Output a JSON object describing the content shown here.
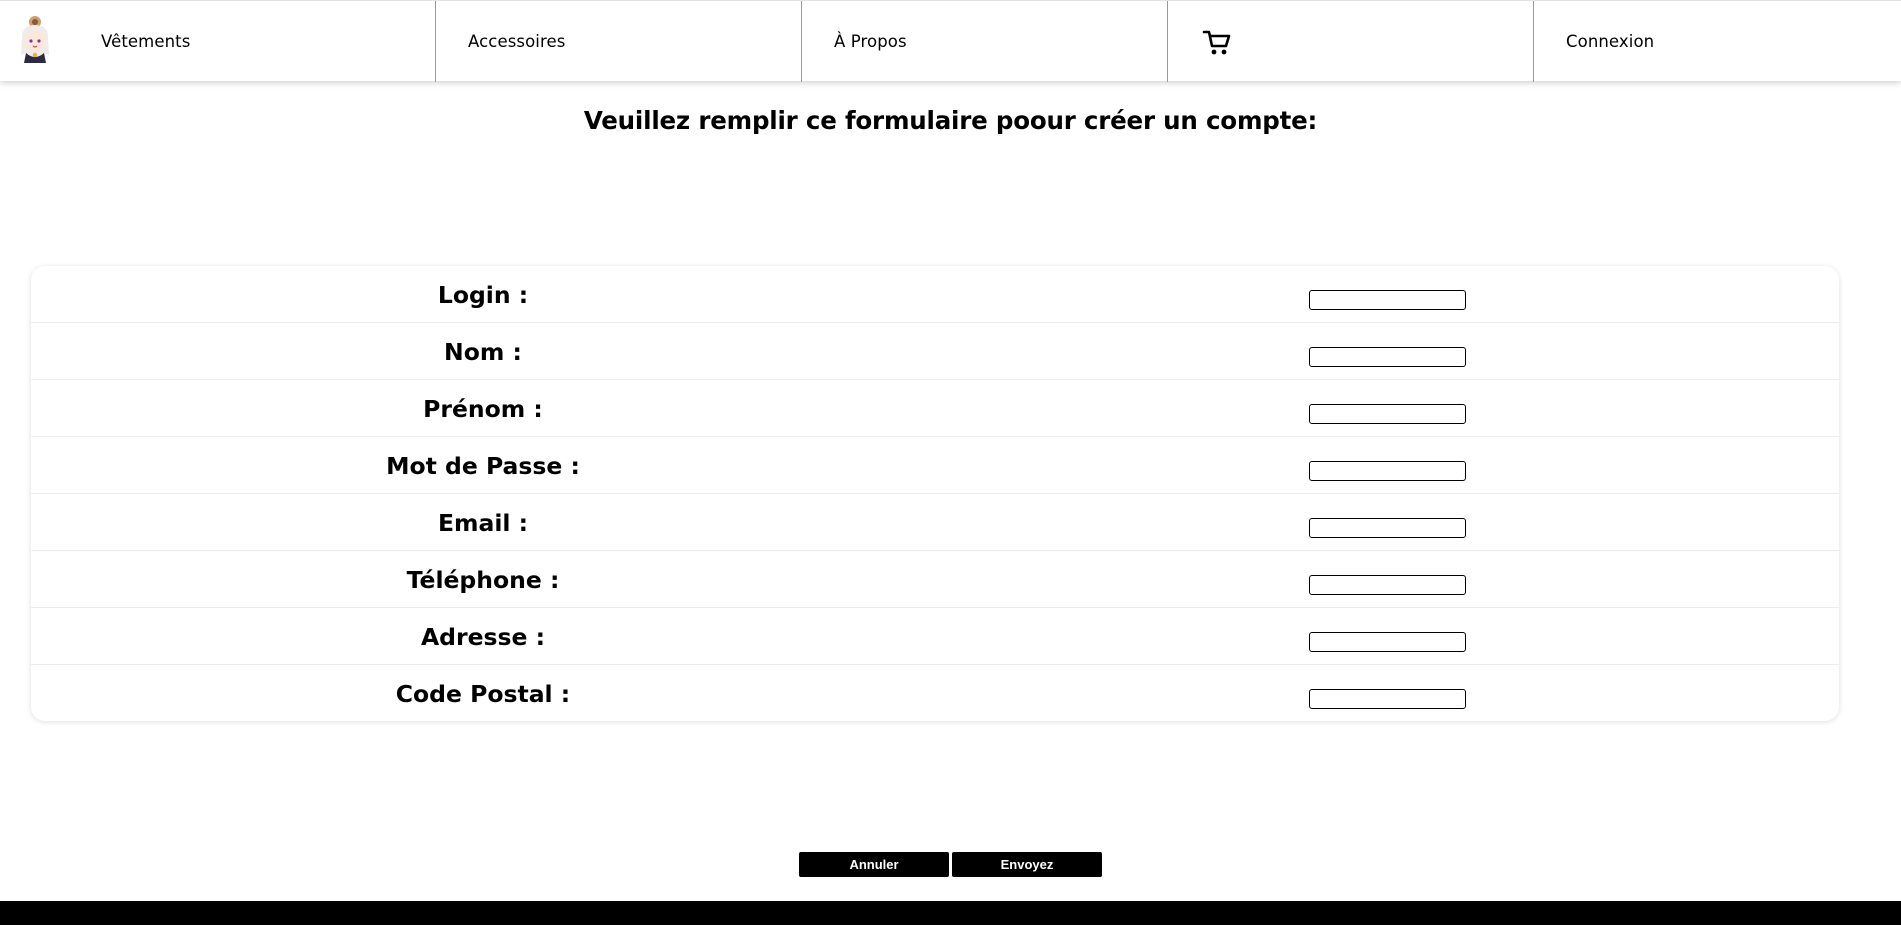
{
  "nav": {
    "logo_icon": "chibi-character-logo-icon",
    "items": [
      {
        "label": "Vêtements"
      },
      {
        "label": "Accessoires"
      },
      {
        "label": "À Propos"
      },
      {
        "icon": "cart-icon"
      },
      {
        "label": "Connexion"
      }
    ]
  },
  "page": {
    "title": "Veuillez remplir ce formulaire poour créer un compte:"
  },
  "form": {
    "fields": [
      {
        "label": "Login :",
        "value": ""
      },
      {
        "label": "Nom :",
        "value": ""
      },
      {
        "label": "Prénom :",
        "value": ""
      },
      {
        "label": "Mot de Passe :",
        "value": ""
      },
      {
        "label": "Email :",
        "value": ""
      },
      {
        "label": "Téléphone :",
        "value": ""
      },
      {
        "label": "Adresse :",
        "value": ""
      },
      {
        "label": "Code Postal :",
        "value": ""
      }
    ]
  },
  "buttons": {
    "cancel_label": "Annuler",
    "submit_label": "Envoyez"
  },
  "colors": {
    "text": "#000000",
    "background": "#ffffff",
    "button_bg": "#000000",
    "button_text": "#ffffff",
    "footer": "#000000"
  }
}
